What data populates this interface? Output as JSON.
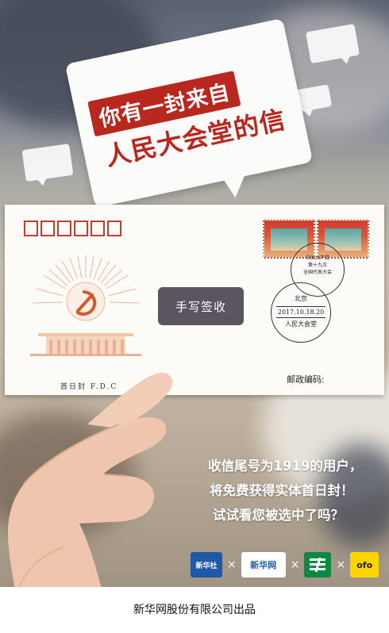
{
  "headline": {
    "line1": "你有一封来自",
    "line2": "人民大会堂的信"
  },
  "envelope": {
    "fdc_label": "首日封 F.D.C",
    "postcode_label": "邮政编码:",
    "postcode_box_count": 6,
    "sign_button_label": "手写签收",
    "postmark_round": [
      "中国共产党",
      "第十九次",
      "全国代表大会"
    ],
    "postmark_date": {
      "city": "北京",
      "date": "2017.10.18.20",
      "place": "人民大会堂"
    }
  },
  "promo": {
    "line1": "收信尾号为1919的用户，",
    "line2": "将免费获得实体首日封！",
    "line3": "试试看您被选中了吗？"
  },
  "partners": [
    {
      "icon": "xinhuashe-logo-icon",
      "label": "新华社"
    },
    {
      "icon": "xinhuanet-logo-icon",
      "label": "新华网"
    },
    {
      "icon": "china-post-logo-icon",
      "label": ""
    },
    {
      "icon": "ofo-logo-icon",
      "label": "ofo"
    }
  ],
  "partner_separator": "×",
  "footer": {
    "credit": "新华网股份有限公司出品"
  },
  "colors": {
    "brand_red": "#b8281f",
    "button_gray": "#5a5561",
    "post_green": "#0c8a44",
    "ofo_yellow": "#ffd500"
  }
}
